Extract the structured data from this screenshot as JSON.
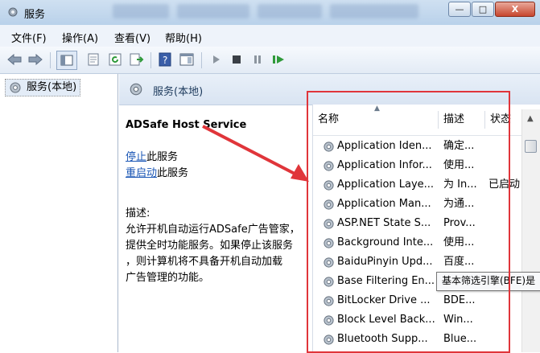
{
  "window": {
    "title": "服务"
  },
  "title_controls": {
    "minimize": "—",
    "maximize": "□",
    "close": "X"
  },
  "menu": [
    "文件(F)",
    "操作(A)",
    "查看(V)",
    "帮助(H)"
  ],
  "tree": {
    "root": "服务(本地)"
  },
  "header": {
    "title": "服务(本地)"
  },
  "detail": {
    "service_name": "ADSafe Host Service",
    "stop_link": "停止",
    "stop_suffix": "此服务",
    "restart_link": "重启动",
    "restart_suffix": "此服务",
    "desc_label": "描述:",
    "desc_lines": [
      "允许开机自动运行ADSafe广告管家，",
      "提供全时功能服务。如果停止该服务",
      "，则计算机将不具备开机自动加载",
      "广告管理的功能。"
    ]
  },
  "list": {
    "columns": [
      "名称",
      "描述",
      "状态"
    ],
    "rows": [
      {
        "name": "Application Iden...",
        "desc": "确定...",
        "status": ""
      },
      {
        "name": "Application Infor...",
        "desc": "使用...",
        "status": ""
      },
      {
        "name": "Application Laye...",
        "desc": "为 In...",
        "status": "已启动"
      },
      {
        "name": "Application Man...",
        "desc": "为通...",
        "status": ""
      },
      {
        "name": "ASP.NET State S...",
        "desc": "Prov...",
        "status": ""
      },
      {
        "name": "Background Inte...",
        "desc": "使用...",
        "status": ""
      },
      {
        "name": "BaiduPinyin Upd...",
        "desc": "百度...",
        "status": ""
      },
      {
        "name": "Base Filtering En...",
        "desc": "",
        "status": ""
      },
      {
        "name": "BitLocker Drive ...",
        "desc": "BDE...",
        "status": ""
      },
      {
        "name": "Block Level Back...",
        "desc": "Win...",
        "status": ""
      },
      {
        "name": "Bluetooth Supp...",
        "desc": "Blue...",
        "status": ""
      }
    ]
  },
  "tooltip": "基本筛选引擎(BFE)是",
  "colors": {
    "annotation": "#e0353a",
    "link": "#1a56b5"
  }
}
